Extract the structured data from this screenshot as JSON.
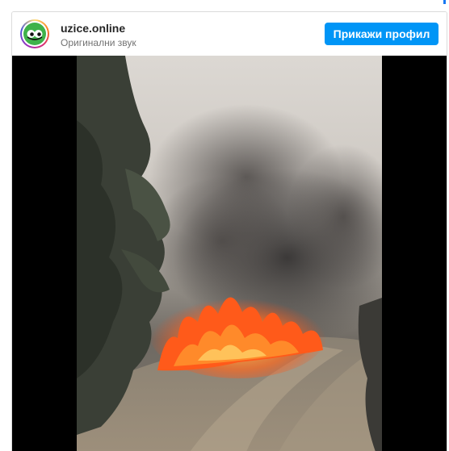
{
  "account": {
    "name": "uzice.online",
    "audio_label": "Оригинални звук",
    "avatar_icon": "eyes-logo-icon"
  },
  "actions": {
    "view_profile_label": "Прикажи профил"
  },
  "colors": {
    "accent": "#0095f6",
    "border": "#dbdbdb",
    "avatar_logo": "#3fb24a"
  }
}
